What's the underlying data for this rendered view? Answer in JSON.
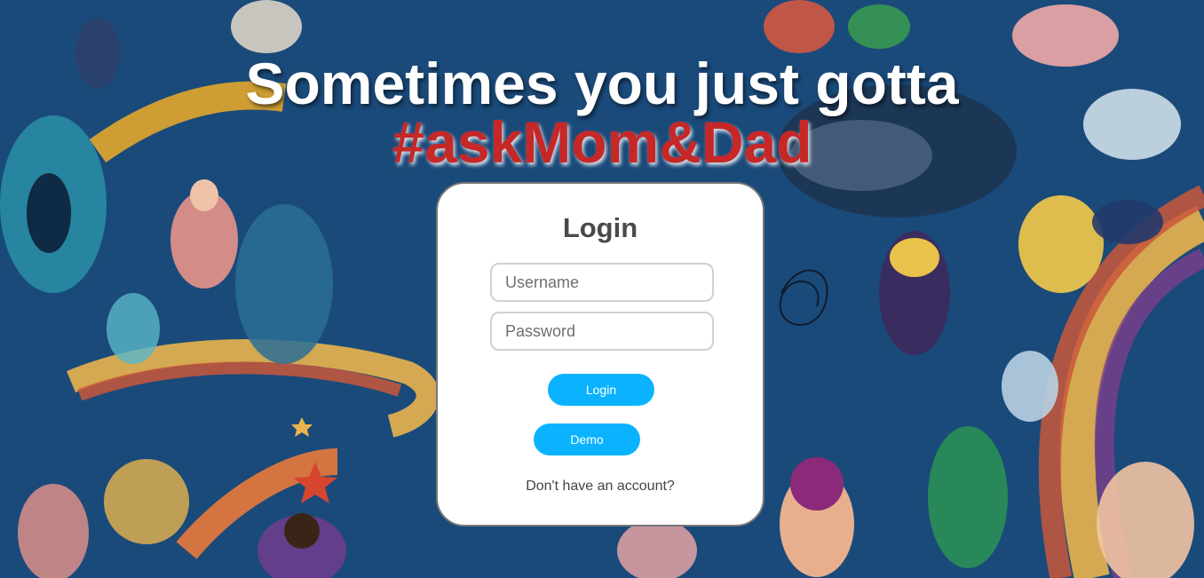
{
  "hero": {
    "headline": "Sometimes you just gotta",
    "hashtag": "#askMom&Dad"
  },
  "login_card": {
    "title": "Login",
    "username_placeholder": "Username",
    "password_placeholder": "Password",
    "login_button": "Login",
    "demo_button": "Demo",
    "signup_link": "Don't have an account?"
  },
  "colors": {
    "background": "#1a4a7a",
    "accent": "#0bb3ff",
    "hashtag": "#c62828"
  }
}
